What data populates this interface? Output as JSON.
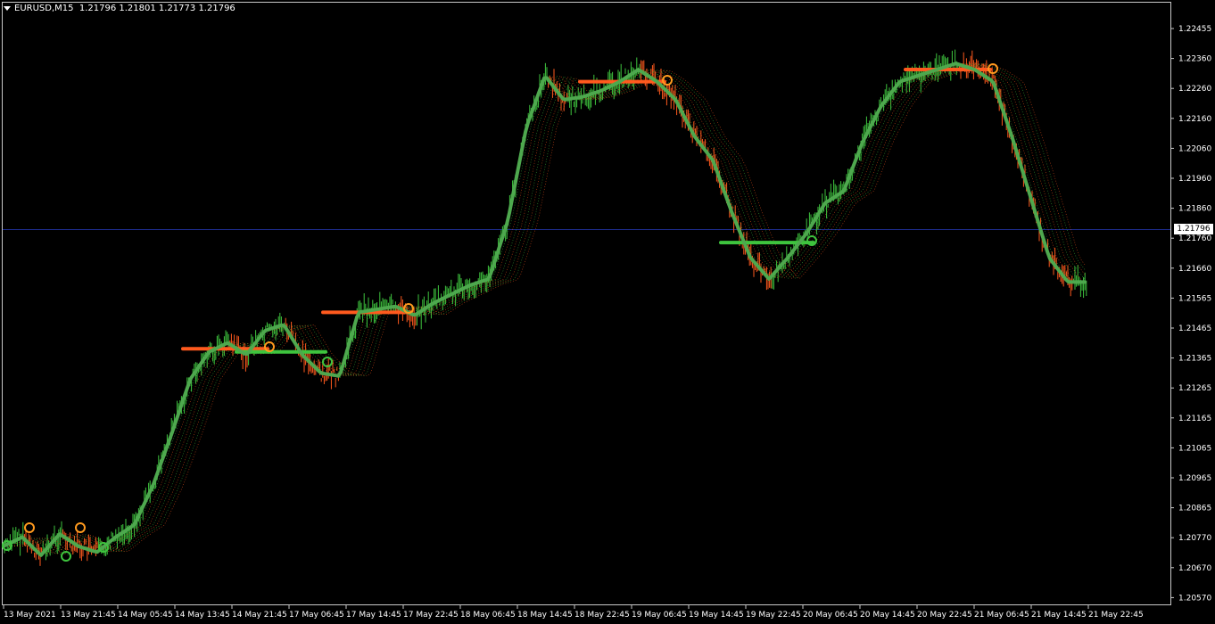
{
  "header": {
    "symbol": "EURUSD,M15",
    "ohlc": "1.21796 1.21801 1.21773 1.21796"
  },
  "current_price": "1.21796",
  "colors": {
    "background": "#000000",
    "up": "#3ec43e",
    "down": "#ff5a1e",
    "ma_thick": "#4ea84e",
    "grid_line": "#1c2b8a"
  },
  "chart_data": {
    "type": "line",
    "title": "",
    "y_ticks": [
      "1.22455",
      "1.22360",
      "1.22260",
      "1.22160",
      "1.22060",
      "1.21960",
      "1.21860",
      "1.21760",
      "1.21660",
      "1.21565",
      "1.21465",
      "1.21365",
      "1.21265",
      "1.21165",
      "1.21065",
      "1.20965",
      "1.20865",
      "1.20770",
      "1.20670",
      "1.20570"
    ],
    "x_ticks": [
      "13 May 2021",
      "13 May 21:45",
      "14 May 05:45",
      "14 May 13:45",
      "14 May 21:45",
      "17 May 06:45",
      "17 May 14:45",
      "17 May 22:45",
      "18 May 06:45",
      "18 May 14:45",
      "18 May 22:45",
      "19 May 06:45",
      "19 May 14:45",
      "19 May 22:45",
      "20 May 06:45",
      "20 May 14:45",
      "20 May 22:45",
      "21 May 06:45",
      "21 May 14:45",
      "21 May 22:45"
    ],
    "ylim": [
      1.2052,
      1.2252
    ],
    "series": [
      {
        "values": [
          1.2075,
          1.2078,
          1.2072,
          1.2079,
          1.2075,
          1.2073,
          1.2078,
          1.2082,
          1.2095,
          1.2112,
          1.213,
          1.2139,
          1.2142,
          1.2138,
          1.2146,
          1.2148,
          1.2138,
          1.2132,
          1.2131,
          1.2152,
          1.2153,
          1.2154,
          1.2151,
          1.2155,
          1.2158,
          1.2161,
          1.2163,
          1.2182,
          1.2213,
          1.223,
          1.2222,
          1.2223,
          1.2225,
          1.2228,
          1.2232,
          1.2228,
          1.2222,
          1.221,
          1.2202,
          1.2185,
          1.217,
          1.2163,
          1.217,
          1.2178,
          1.2188,
          1.2192,
          1.2208,
          1.222,
          1.2228,
          1.223,
          1.2232,
          1.2234,
          1.2232,
          1.2228,
          1.221,
          1.219,
          1.217,
          1.2162,
          1.2162
        ]
      }
    ]
  }
}
